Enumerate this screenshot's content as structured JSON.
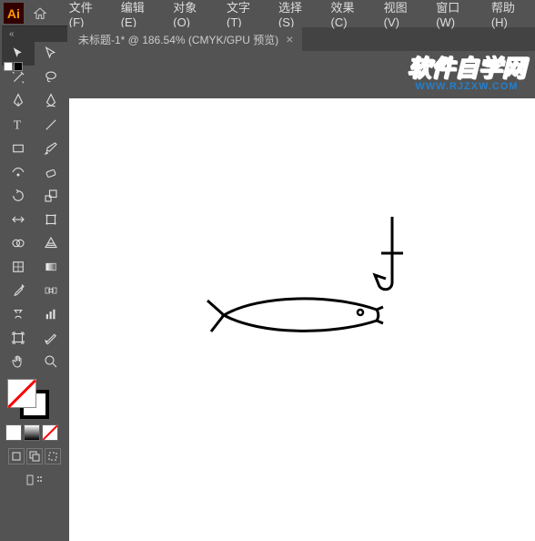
{
  "app": {
    "icon_text": "Ai"
  },
  "menu": {
    "items": [
      {
        "label": "文件(F)"
      },
      {
        "label": "编辑(E)"
      },
      {
        "label": "对象(O)"
      },
      {
        "label": "文字(T)"
      },
      {
        "label": "选择(S)"
      },
      {
        "label": "效果(C)"
      },
      {
        "label": "视图(V)"
      },
      {
        "label": "窗口(W)"
      },
      {
        "label": "帮助(H)"
      }
    ]
  },
  "tab": {
    "title": "未标题-1* @ 186.54% (CMYK/GPU 预览)",
    "close": "×"
  },
  "watermark": {
    "main": "软件自学网",
    "sub": "WWW.RJZXW.COM"
  }
}
